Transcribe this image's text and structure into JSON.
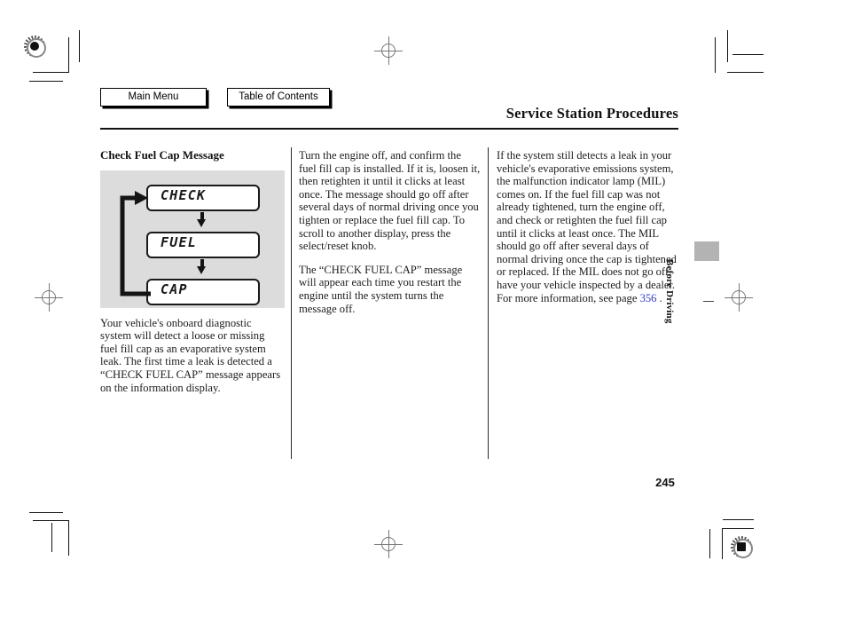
{
  "nav": {
    "main_menu_label": "Main Menu",
    "table_of_contents_label": "Table of Contents"
  },
  "header": {
    "title": "Service Station Procedures"
  },
  "columns": {
    "left": {
      "heading": "Check Fuel Cap Message",
      "figure": {
        "caption_boxes": [
          "CHECK",
          "FUEL",
          "CAP"
        ],
        "background_color": "#dcdcdc",
        "loop_description": "loop-back arrow from CAP to CHECK"
      },
      "paragraph": "Your vehicle's onboard diagnostic system will detect a loose or missing fuel fill cap as an evaporative system leak. The first time a leak is detected a “CHECK FUEL CAP” message appears on the information display."
    },
    "middle": {
      "paragraph_1": "Turn the engine off, and confirm the fuel fill cap is installed. If it is, loosen it, then retighten it until it clicks at least once. The message should go off after several days of normal driving once you tighten or replace the fuel fill cap. To scroll to another display, press the select/reset knob.",
      "paragraph_2": "The “CHECK FUEL CAP” message will appear each time you restart the engine until the system turns the message off."
    },
    "right": {
      "paragraph_before_link": "If the system still detects a leak in your vehicle's evaporative emissions system, the malfunction indicator lamp (MIL) comes on. If the fuel fill cap was not already tightened, turn the engine off, and check or retighten the fuel fill cap until it clicks at least once. The MIL should go off after several days of normal driving once the cap is tightened or replaced. If the MIL does not go off, have your vehicle inspected by a dealer. For more information, see page ",
      "page_link": "356",
      "paragraph_after_link": " ."
    }
  },
  "side_tab": {
    "label": "Before Driving",
    "tab_color": "#b3b3b3"
  },
  "footer": {
    "page_number": "245"
  },
  "colors": {
    "link": "#2b3ed1",
    "text": "#1c1c1c",
    "rule": "#111111"
  }
}
